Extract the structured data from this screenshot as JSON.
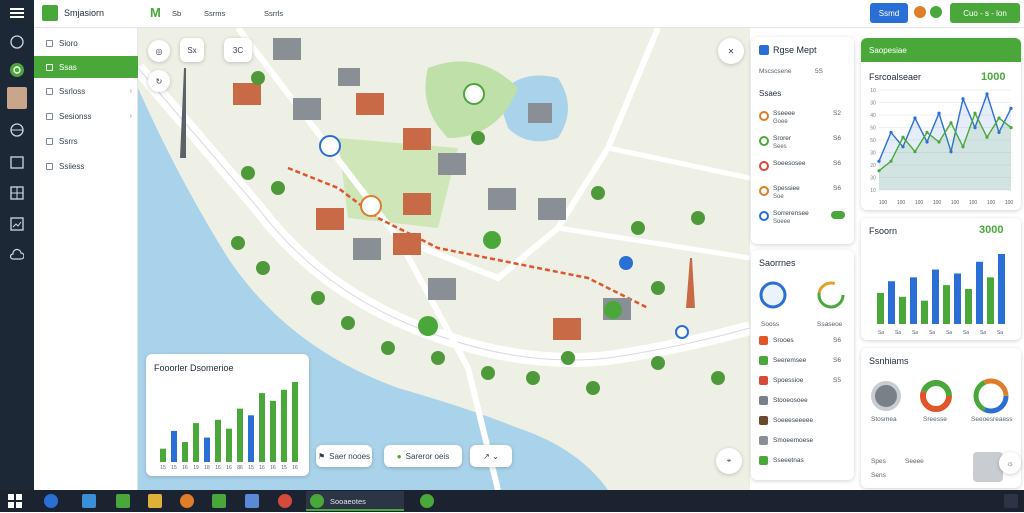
{
  "app": {
    "title": "Smjasiorn",
    "brand_color": "#4aa83a",
    "accent_blue": "#2a6fd6"
  },
  "topbar": {
    "tab1": "Sb",
    "tab2": "Ssrms",
    "tab3": "Ssrrls",
    "primary_button": "Ssmd",
    "cta_button": "Cuo - s - lon"
  },
  "rail_icons": [
    "menu-icon",
    "compass-icon",
    "gps-icon",
    "avatar",
    "globe-icon",
    "calendar-icon",
    "grid-icon",
    "chart-icon",
    "cloud-icon"
  ],
  "sidebar": {
    "items": [
      "Sioro",
      "Ssas",
      "Ssrloss",
      "Sesionss",
      "Ssrrs",
      "Ssiiess"
    ],
    "active_index": 1
  },
  "map": {
    "zoom_label": "Sx",
    "tool_label": "3C",
    "bottom_toolbar": {
      "legend_label": "Saer nooes",
      "status_label": "Sareror oeis"
    },
    "overlay_chart": {
      "title": "Fooorler Dsomerioe",
      "values": [
        12,
        28,
        18,
        35,
        22,
        38,
        30,
        48,
        42,
        62,
        55,
        65,
        72
      ],
      "colors": [
        "#4aa83a",
        "#2a6fd6",
        "#4aa83a",
        "#4aa83a",
        "#2a6fd6",
        "#4aa83a",
        "#4aa83a",
        "#4aa83a",
        "#2a6fd6",
        "#4aa83a",
        "#4aa83a",
        "#4aa83a",
        "#4aa83a"
      ],
      "xlabels": [
        "15",
        "15",
        "16",
        "19",
        "18",
        "16",
        "16",
        "86",
        "15",
        "16",
        "16",
        "15",
        "16"
      ]
    }
  },
  "route_panel": {
    "title": "Rgse Mept",
    "subtitle": "Mscscsene",
    "subtitle_value": "5S",
    "section": "Ssaes",
    "rows": [
      {
        "label": "Sseeee",
        "sub": "Goee",
        "value": "S2",
        "color": "#e07d2a"
      },
      {
        "label": "Srorer",
        "sub": "Sees",
        "value": "S6",
        "color": "#4aa83a"
      },
      {
        "label": "Soeesosee",
        "sub": "",
        "value": "S6",
        "color": "#d64a3a"
      },
      {
        "label": "Spessiee",
        "sub": "Soe",
        "value": "S6",
        "color": "#e07d2a"
      },
      {
        "label": "Sorrerensee",
        "sub": "Soeee",
        "value": "",
        "color": "#2a6fd6"
      }
    ]
  },
  "stats_panel": {
    "title": "Saorrnes",
    "gauge1": "Sooss",
    "gauge2": "Ssaseoe",
    "rows": [
      {
        "label": "Srooes",
        "value": "S6"
      },
      {
        "label": "Seeremsee",
        "value": "S6"
      },
      {
        "label": "Spoessioe",
        "value": "S5"
      },
      {
        "label": "Stooeosoee",
        "value": ""
      },
      {
        "label": "Soeeeseeeee",
        "value": ""
      },
      {
        "label": "Smoeemoese",
        "value": ""
      },
      {
        "label": "Sseeetnas",
        "value": ""
      }
    ]
  },
  "right_top": {
    "header": "Saopesiae",
    "title": "Fsrcoalseaer",
    "value": "1000",
    "y_ticks": [
      "10",
      "30",
      "40",
      "50",
      "50",
      "30",
      "20",
      "30",
      "10"
    ],
    "x_ticks": [
      "100",
      "100",
      "100",
      "100",
      "100",
      "100",
      "100",
      "100"
    ],
    "line1": [
      30,
      60,
      45,
      75,
      50,
      80,
      40,
      95,
      65,
      100,
      60,
      85
    ],
    "line2": [
      20,
      30,
      55,
      40,
      60,
      50,
      70,
      45,
      80,
      55,
      75,
      65
    ]
  },
  "right_mid": {
    "title": "Fsoorn",
    "value": "3000",
    "values": [
      40,
      55,
      35,
      60,
      30,
      70,
      50,
      65,
      45,
      80,
      60,
      90
    ],
    "xlabels": [
      "Sa",
      "Sa",
      "Sa",
      "Sa",
      "Sa",
      "Sa",
      "Sa",
      "Sa"
    ]
  },
  "right_bot": {
    "title": "Ssnhiams",
    "d1": "Stosmea",
    "d2": "Sreesse",
    "d3": "Seeoesreaess",
    "legend": [
      "Spes",
      "Seeee",
      "Sens"
    ]
  },
  "taskbar": {
    "active_app": "Sooaeotes"
  }
}
